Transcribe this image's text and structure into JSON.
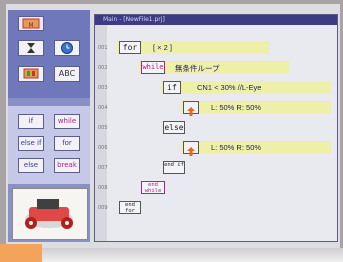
{
  "palette": {
    "timer_icon": "hourglass-icon",
    "clock_icon": "clock-icon",
    "monitor_icon": "monitor-icon",
    "top_label": "ABC",
    "buttons": [
      "if",
      "while",
      "else if",
      "for",
      "else",
      "break"
    ]
  },
  "editor": {
    "title": "Main - [NewFile1.prj]",
    "rows": [
      {
        "num": "001",
        "block": "for",
        "text": "[ × 2 ]"
      },
      {
        "num": "002",
        "block": "while",
        "text": "無条件ループ"
      },
      {
        "num": "003",
        "block": "if",
        "text": "CN1 < 30% //L-Eye"
      },
      {
        "num": "004",
        "block": "motor",
        "text": "L: 50%  R: 50%"
      },
      {
        "num": "005",
        "block": "else",
        "text": ""
      },
      {
        "num": "006",
        "block": "motor",
        "text": "L: 50%  R: 50%"
      },
      {
        "num": "007",
        "block": "end if",
        "text": ""
      },
      {
        "num": "008",
        "block": "end while",
        "text": ""
      },
      {
        "num": "009",
        "block": "end for",
        "text": ""
      }
    ]
  },
  "colors": {
    "accent": "#3d3b84",
    "keyword": "#b0208a",
    "highlight": "#eef0a8"
  }
}
